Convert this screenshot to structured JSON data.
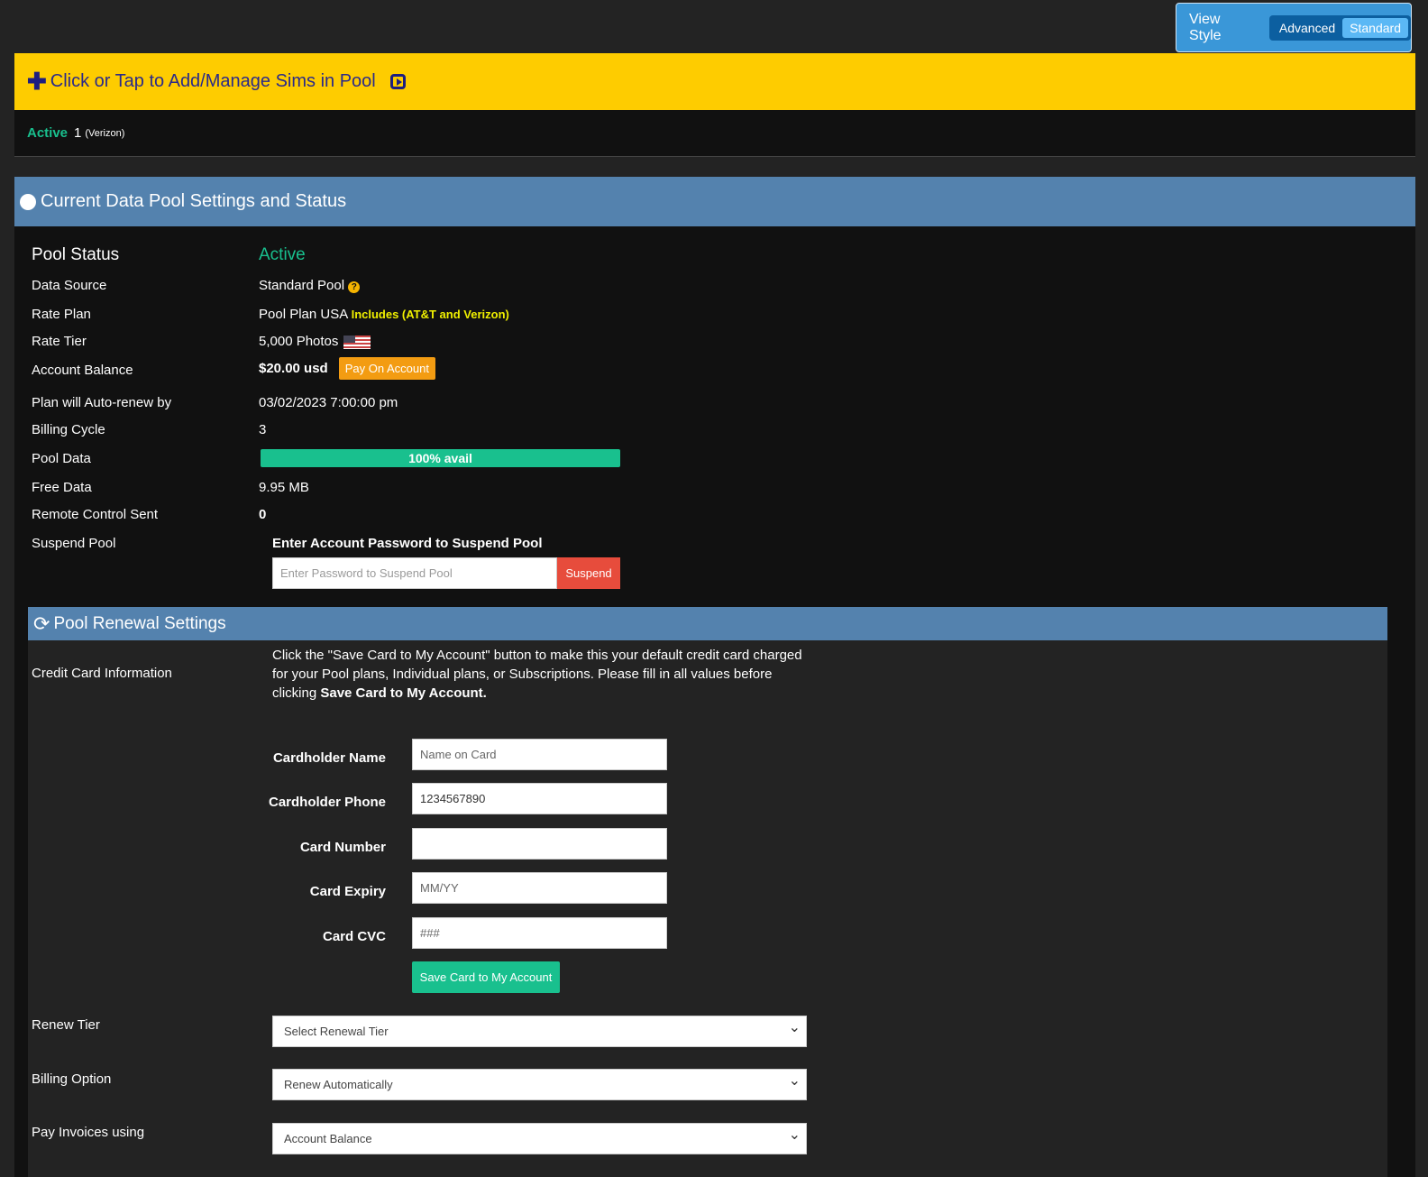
{
  "view_style": {
    "label": "View Style",
    "options": [
      "Advanced",
      "Standard"
    ],
    "selected": "Standard"
  },
  "add_bar": {
    "label": "Click or Tap to Add/Manage Sims in Pool"
  },
  "sims": {
    "status": "Active",
    "count": "1",
    "carrier": "(Verizon)"
  },
  "pool_header": {
    "title": "Current Data Pool Settings and Status"
  },
  "pool": {
    "status_label": "Pool Status",
    "status_value": "Active",
    "data_source_label": "Data Source",
    "data_source_value": "Standard Pool",
    "rate_plan_label": "Rate Plan",
    "rate_plan_value": "Pool Plan USA",
    "rate_plan_note": "Includes (AT&T and Verizon)",
    "rate_tier_label": "Rate Tier",
    "rate_tier_value": "5,000 Photos",
    "balance_label": "Account Balance",
    "balance_value": "$20.00 usd",
    "pay_button": "Pay On Account",
    "renew_label": "Plan will Auto-renew by",
    "renew_value": "03/02/2023 7:00:00 pm",
    "cycle_label": "Billing Cycle",
    "cycle_value": "3",
    "pool_data_label": "Pool Data",
    "pool_data_value": "100% avail",
    "pool_data_percent": 100,
    "free_label": "Free Data",
    "free_value": "9.95 MB",
    "remote_label": "Remote Control Sent",
    "remote_value": "0",
    "suspend_label": "Suspend Pool",
    "suspend_prompt": "Enter Account Password to Suspend Pool",
    "suspend_placeholder": "Enter Password to Suspend Pool",
    "suspend_button": "Suspend"
  },
  "renewal": {
    "title": "Pool Renewal Settings",
    "cc_label": "Credit Card Information",
    "cc_text": "Click the \"Save Card to My Account\" button to make this your default credit card charged for your Pool plans, Individual plans, or Subscriptions. Please fill in all values before clicking",
    "cc_text_bold": "Save Card to My Account.",
    "name_label": "Cardholder Name",
    "name_placeholder": "Name on Card",
    "phone_label": "Cardholder Phone",
    "phone_value": "1234567890",
    "number_label": "Card Number",
    "number_value": "",
    "expiry_label": "Card Expiry",
    "expiry_placeholder": "MM/YY",
    "cvc_label": "Card CVC",
    "cvc_placeholder": "###",
    "save_button": "Save Card to My Account",
    "tier_label": "Renew Tier",
    "tier_value": "Select Renewal Tier",
    "billing_label": "Billing Option",
    "billing_value": "Renew Automatically",
    "invoice_label": "Pay Invoices using",
    "invoice_value": "Account Balance"
  }
}
